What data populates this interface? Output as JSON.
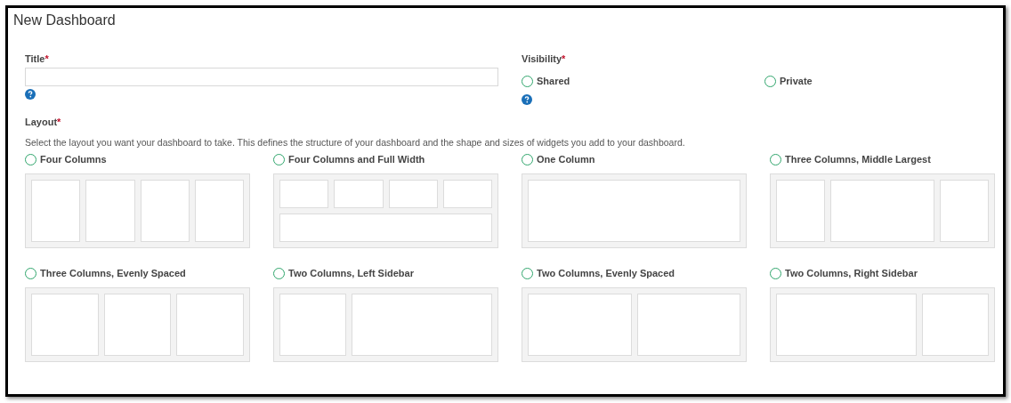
{
  "page": {
    "title": "New Dashboard"
  },
  "title_field": {
    "label": "Title",
    "required_mark": "*"
  },
  "visibility": {
    "label": "Visibility",
    "required_mark": "*",
    "options": [
      {
        "label": "Shared",
        "selected": false
      },
      {
        "label": "Private",
        "selected": false
      }
    ]
  },
  "layout": {
    "label": "Layout",
    "required_mark": "*",
    "description": "Select the layout you want your dashboard to take. This defines the structure of your dashboard and the shape and sizes of widgets you add to your dashboard.",
    "options": [
      {
        "label": "Four Columns",
        "selected": false,
        "kind": "four-columns"
      },
      {
        "label": "Four Columns and Full Width",
        "selected": false,
        "kind": "four-columns-full"
      },
      {
        "label": "One Column",
        "selected": false,
        "kind": "one-column"
      },
      {
        "label": "Three Columns, Middle Largest",
        "selected": false,
        "kind": "three-middle"
      },
      {
        "label": "Three Columns, Evenly Spaced",
        "selected": false,
        "kind": "three-even"
      },
      {
        "label": "Two Columns, Left Sidebar",
        "selected": false,
        "kind": "two-left"
      },
      {
        "label": "Two Columns, Evenly Spaced",
        "selected": false,
        "kind": "two-even"
      },
      {
        "label": "Two Columns, Right Sidebar",
        "selected": false,
        "kind": "two-right"
      }
    ]
  }
}
